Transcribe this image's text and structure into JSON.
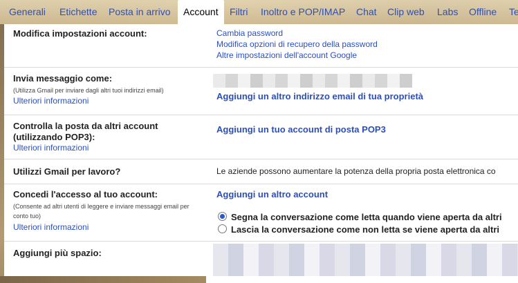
{
  "tabs": [
    {
      "label": "Generali",
      "active": false
    },
    {
      "label": "Etichette",
      "active": false
    },
    {
      "label": "Posta in arrivo",
      "active": false
    },
    {
      "label": "Account",
      "active": true
    },
    {
      "label": "Filtri",
      "active": false
    },
    {
      "label": "Inoltro e POP/IMAP",
      "active": false
    },
    {
      "label": "Chat",
      "active": false
    },
    {
      "label": "Clip web",
      "active": false
    },
    {
      "label": "Labs",
      "active": false
    },
    {
      "label": "Offline",
      "active": false
    },
    {
      "label": "Te",
      "active": false
    }
  ],
  "rows": {
    "modifica": {
      "label": "Modifica impostazioni account:",
      "links": [
        "Cambia password",
        "Modifica opzioni di recupero della password",
        "Altre impostazioni dell'account Google"
      ]
    },
    "invia": {
      "label": "Invia messaggio come:",
      "note": "(Utilizza Gmail per inviare dagli altri tuoi indirizzi email)",
      "more": "Ulteriori informazioni",
      "action": "Aggiungi un altro indirizzo email di tua proprietà"
    },
    "controlla": {
      "label_line1": "Controlla la posta da altri account",
      "label_line2": "(utilizzando POP3):",
      "more": "Ulteriori informazioni",
      "action": "Aggiungi un tuo account di posta POP3"
    },
    "lavoro": {
      "label": "Utilizzi Gmail per lavoro?",
      "text": "Le aziende possono aumentare la potenza della propria posta elettronica co"
    },
    "accesso": {
      "label": "Concedi l'accesso al tuo account:",
      "note_line1": "(Consente ad altri utenti di leggere e inviare messaggi email per",
      "note_line2": "conto tuo)",
      "more": "Ulteriori informazioni",
      "action": "Aggiungi un altro account",
      "options": [
        {
          "label": "Segna la conversazione come letta quando viene aperta da altri",
          "selected": true
        },
        {
          "label": "Lascia la conversazione come non letta se viene aperta da altri",
          "selected": false
        }
      ]
    },
    "spazio": {
      "label": "Aggiungi più spazio:"
    }
  }
}
